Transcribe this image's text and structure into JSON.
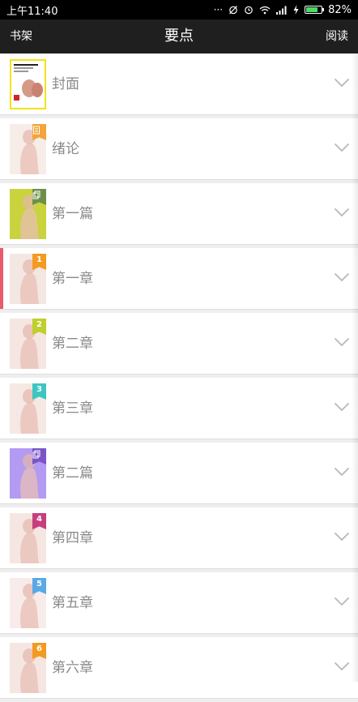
{
  "status_bar": {
    "time": "上午11:40",
    "battery": "82%",
    "battery_level": 0.82,
    "icons": [
      "more-icon",
      "alarm-off-icon",
      "alarm-icon",
      "wifi-icon",
      "signal-icon",
      "charging-icon",
      "battery-icon"
    ]
  },
  "nav": {
    "left": "书架",
    "title": "要点",
    "right": "阅读"
  },
  "rows": [
    {
      "label": "封面",
      "badge": "",
      "badge_type": "cover",
      "badge_color": "",
      "thumb_color": "#ffffff",
      "accent": ""
    },
    {
      "label": "绪论",
      "badge": "",
      "badge_type": "doc",
      "badge_color": "#f3a43b",
      "thumb_color": "#f6ece8",
      "accent": ""
    },
    {
      "label": "第一篇",
      "badge": "",
      "badge_type": "copy",
      "badge_color": "#6e8f4a",
      "thumb_color": "#c9d33d",
      "accent": ""
    },
    {
      "label": "第一章",
      "badge": "1",
      "badge_type": "number",
      "badge_color": "#f39a22",
      "thumb_color": "#f4e6e2",
      "accent": "#e85a6c"
    },
    {
      "label": "第二章",
      "badge": "2",
      "badge_type": "number",
      "badge_color": "#bfcf2c",
      "thumb_color": "#f6e6e2",
      "accent": ""
    },
    {
      "label": "第三章",
      "badge": "3",
      "badge_type": "number",
      "badge_color": "#3cc6c0",
      "thumb_color": "#f6e8e4",
      "accent": ""
    },
    {
      "label": "第二篇",
      "badge": "",
      "badge_type": "copy",
      "badge_color": "#7a55c8",
      "thumb_color": "#b39af2",
      "accent": ""
    },
    {
      "label": "第四章",
      "badge": "4",
      "badge_type": "number",
      "badge_color": "#c63e7e",
      "thumb_color": "#f6e6e2",
      "accent": ""
    },
    {
      "label": "第五章",
      "badge": "5",
      "badge_type": "number",
      "badge_color": "#5aa8e8",
      "thumb_color": "#f7ecea",
      "accent": ""
    },
    {
      "label": "第六章",
      "badge": "6",
      "badge_type": "number",
      "badge_color": "#f39a22",
      "thumb_color": "#f6e6e2",
      "accent": ""
    }
  ]
}
